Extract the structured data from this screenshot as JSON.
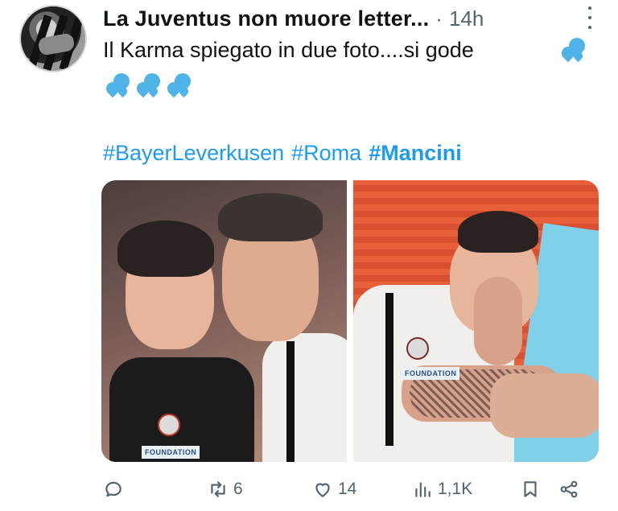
{
  "post": {
    "author": "La Juventus non muore letter...",
    "separator": "·",
    "time": "14h",
    "text": "Il Karma spiegato in due foto....si gode",
    "hashtags": [
      "#BayerLeverkusen",
      "#Roma",
      "#Mancini"
    ],
    "emoji": "sweat-droplets"
  },
  "media": {
    "photos": [
      {
        "label": "FOUNDATION"
      },
      {
        "label": "FOUNDATION"
      }
    ]
  },
  "actions": {
    "reply": "",
    "repost": "6",
    "like": "14",
    "views": "1,1K"
  },
  "colors": {
    "link": "#1d9bf0",
    "muted": "#536471",
    "emoji": "#4fb3e8"
  }
}
